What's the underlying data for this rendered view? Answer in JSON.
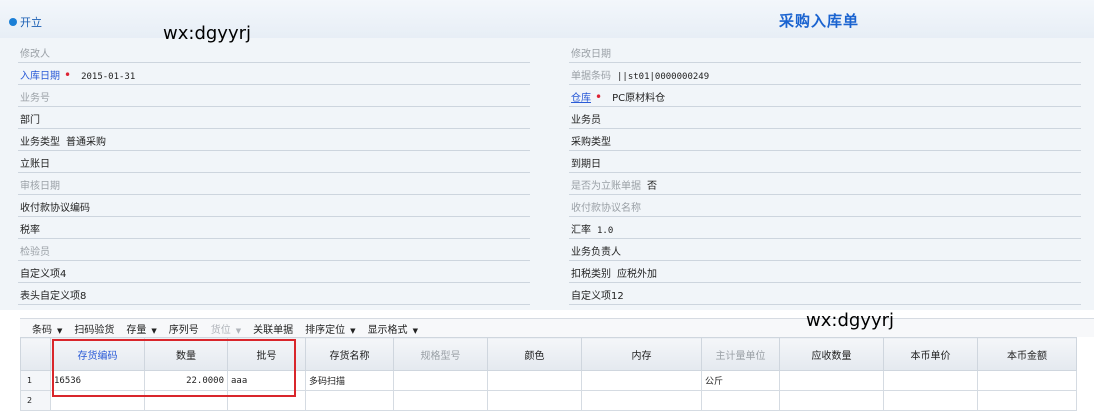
{
  "status": {
    "label": "开立",
    "color": "#1b7fd6"
  },
  "title": "采购入库单",
  "watermarks": [
    "wx:dgyyrj",
    "wx:dgyyrj"
  ],
  "left_fields": [
    {
      "label": "修改人",
      "value": "",
      "style": "gray",
      "required": false
    },
    {
      "label": "入库日期",
      "value": "2015-01-31",
      "style": "blue",
      "required": true
    },
    {
      "label": "业务号",
      "value": "",
      "style": "gray",
      "required": false
    },
    {
      "label": "部门",
      "value": "",
      "style": "normal",
      "required": false
    },
    {
      "label": "业务类型",
      "value": "普通采购",
      "style": "normal",
      "required": false
    },
    {
      "label": "立账日",
      "value": "",
      "style": "normal",
      "required": false
    },
    {
      "label": "审核日期",
      "value": "",
      "style": "gray",
      "required": false
    },
    {
      "label": "收付款协议编码",
      "value": "",
      "style": "normal",
      "required": false
    },
    {
      "label": "税率",
      "value": "",
      "style": "normal",
      "required": false
    },
    {
      "label": "检验员",
      "value": "",
      "style": "gray",
      "required": false
    },
    {
      "label": "自定义项4",
      "value": "",
      "style": "normal",
      "required": false
    },
    {
      "label": "表头自定义项8",
      "value": "",
      "style": "normal",
      "required": false
    }
  ],
  "right_fields": [
    {
      "label": "修改日期",
      "value": "",
      "style": "gray",
      "required": false
    },
    {
      "label": "单据条码",
      "value": "||st01|0000000249",
      "style": "gray",
      "required": false
    },
    {
      "label": "仓库",
      "value": "PC原材料仓",
      "style": "link",
      "required": true
    },
    {
      "label": "业务员",
      "value": "",
      "style": "normal",
      "required": false
    },
    {
      "label": "采购类型",
      "value": "",
      "style": "normal",
      "required": false
    },
    {
      "label": "到期日",
      "value": "",
      "style": "normal",
      "required": false
    },
    {
      "label": "是否为立账单据",
      "value": "否",
      "style": "gray",
      "required": false
    },
    {
      "label": "收付款协议名称",
      "value": "",
      "style": "gray",
      "required": false
    },
    {
      "label": "汇率",
      "value": "1.0",
      "style": "normal",
      "required": false
    },
    {
      "label": "业务负责人",
      "value": "",
      "style": "normal",
      "required": false
    },
    {
      "label": "扣税类别",
      "value": "应税外加",
      "style": "normal",
      "required": false
    },
    {
      "label": "自定义项12",
      "value": "",
      "style": "normal",
      "required": false
    }
  ],
  "toolbar": [
    {
      "label": "条码",
      "dropdown": true,
      "disabled": false
    },
    {
      "label": "扫码验货",
      "dropdown": false,
      "disabled": false
    },
    {
      "label": "存量",
      "dropdown": true,
      "disabled": false
    },
    {
      "label": "序列号",
      "dropdown": false,
      "disabled": false
    },
    {
      "label": "货位",
      "dropdown": true,
      "disabled": true
    },
    {
      "label": "关联单据",
      "dropdown": false,
      "disabled": false
    },
    {
      "label": "排序定位",
      "dropdown": true,
      "disabled": false
    },
    {
      "label": "显示格式",
      "dropdown": true,
      "disabled": false
    }
  ],
  "grid": {
    "columns": [
      {
        "label": "",
        "style": "normal"
      },
      {
        "label": "存货编码",
        "style": "blue"
      },
      {
        "label": "数量",
        "style": "normal"
      },
      {
        "label": "批号",
        "style": "normal"
      },
      {
        "label": "存货名称",
        "style": "normal"
      },
      {
        "label": "规格型号",
        "style": "gray"
      },
      {
        "label": "颜色",
        "style": "normal"
      },
      {
        "label": "内存",
        "style": "normal"
      },
      {
        "label": "主计量单位",
        "style": "gray"
      },
      {
        "label": "应收数量",
        "style": "normal"
      },
      {
        "label": "本币单价",
        "style": "normal"
      },
      {
        "label": "本币金额",
        "style": "normal"
      }
    ],
    "rows": [
      [
        "1",
        "16536",
        "22.0000",
        "aaa",
        "多码扫描",
        "",
        "",
        "",
        "公斤",
        "",
        "",
        ""
      ],
      [
        "2",
        "",
        "",
        "",
        "",
        "",
        "",
        "",
        "",
        "",
        "",
        ""
      ]
    ]
  },
  "highlight_color": "#d9262b"
}
